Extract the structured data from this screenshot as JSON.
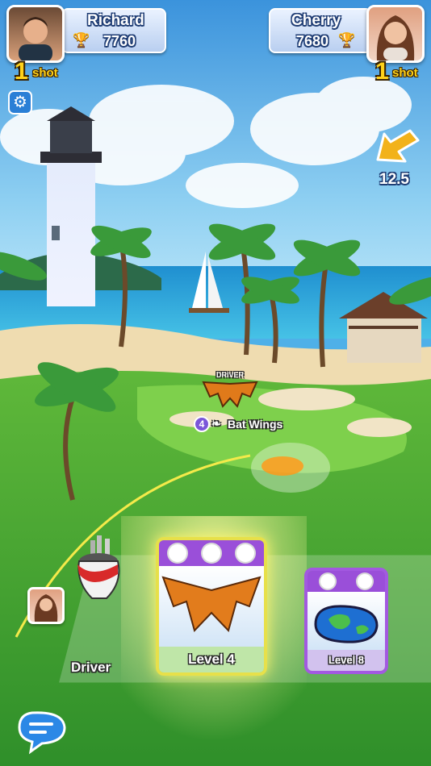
{
  "players": {
    "left": {
      "name": "Richard",
      "score": "7760",
      "shots": "1",
      "shots_label": "shot"
    },
    "right": {
      "name": "Cherry",
      "score": "7680",
      "shots": "1",
      "shots_label": "shot"
    }
  },
  "wind": {
    "value": "12.5"
  },
  "course": {
    "club_label": "DRIVER",
    "club_badge_level": "4",
    "club_name": "Bat Wings"
  },
  "tray": {
    "label": "Driver"
  },
  "cards": [
    {
      "level_label": "Level 4",
      "icons": [
        "power-icon",
        "spin-icon",
        "accuracy-icon"
      ],
      "border": "#e7e04a",
      "top": "#9a4fd9"
    },
    {
      "level_label": "Level 8",
      "icons": [
        "power-icon",
        "curl-icon"
      ],
      "border": "#a259e0",
      "top": "#9a4fd9"
    }
  ],
  "colors": {
    "accent_gold": "#ffd21a",
    "plate_text_outline": "#1f3d74",
    "card_purple": "#9a4fd9"
  },
  "icons": {
    "settings": "gear-icon",
    "chat": "chat-icon",
    "trophy": "trophy-icon",
    "wind": "wind-arrow-icon"
  }
}
